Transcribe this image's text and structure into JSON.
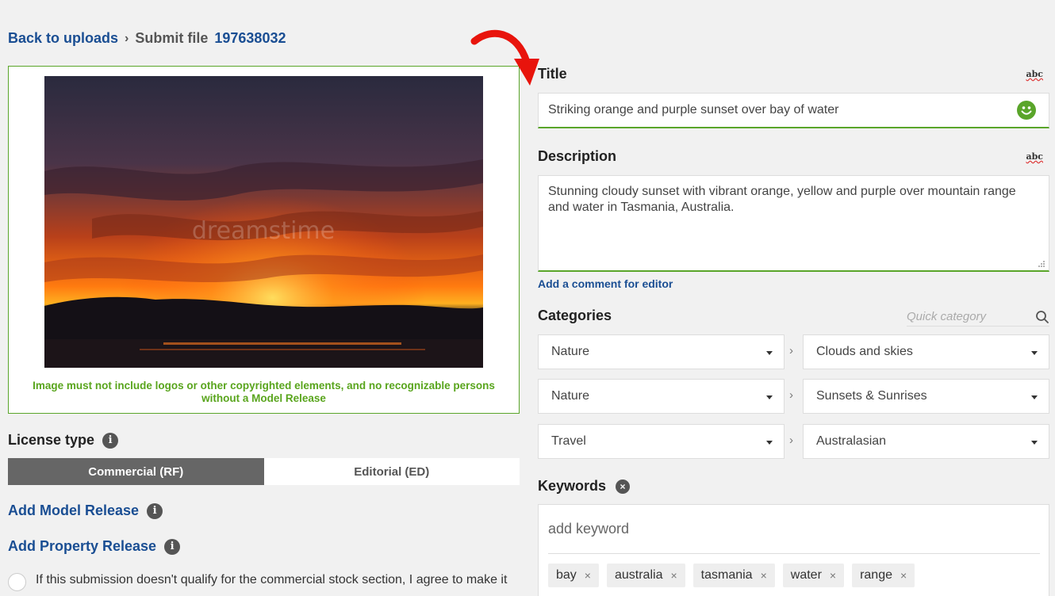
{
  "breadcrumb": {
    "back_label": "Back to uploads",
    "separator": "›",
    "current_label": "Submit file",
    "file_id": "197638032"
  },
  "preview": {
    "watermark": "dreamstime",
    "warning": "Image must not include logos or other copyrighted elements, and no recognizable persons without a Model Release"
  },
  "license": {
    "title": "License type",
    "tabs": [
      {
        "label": "Commercial (RF)",
        "active": true
      },
      {
        "label": "Editorial (ED)",
        "active": false
      }
    ]
  },
  "releases": {
    "model": "Add Model Release",
    "property": "Add Property Release"
  },
  "agreement": {
    "text": "If this submission doesn't qualify for the commercial stock section, I agree to make it"
  },
  "info_glyph": "i",
  "title_field": {
    "label": "Title",
    "spell_label": "abc",
    "value": "Striking orange and purple sunset over bay of water",
    "status_icon": "smiley-icon"
  },
  "description_field": {
    "label": "Description",
    "spell_label": "abc",
    "value": "Stunning cloudy sunset with vibrant orange, yellow and purple over mountain range and water in Tasmania, Australia.",
    "comment_link": "Add a comment for editor"
  },
  "categories": {
    "label": "Categories",
    "quick_placeholder": "Quick category",
    "separator": "›",
    "rows": [
      {
        "main": "Nature",
        "sub": "Clouds and skies"
      },
      {
        "main": "Nature",
        "sub": "Sunsets & Sunrises"
      },
      {
        "main": "Travel",
        "sub": "Australasian"
      }
    ]
  },
  "keywords": {
    "label": "Keywords",
    "clear_glyph": "×",
    "placeholder": "add keyword",
    "remove_glyph": "×",
    "tags": [
      "bay",
      "australia",
      "tasmania",
      "water",
      "range"
    ]
  },
  "colors": {
    "link": "#1a4e93",
    "success": "#5aa52a",
    "annotation_arrow": "#e8140c"
  }
}
